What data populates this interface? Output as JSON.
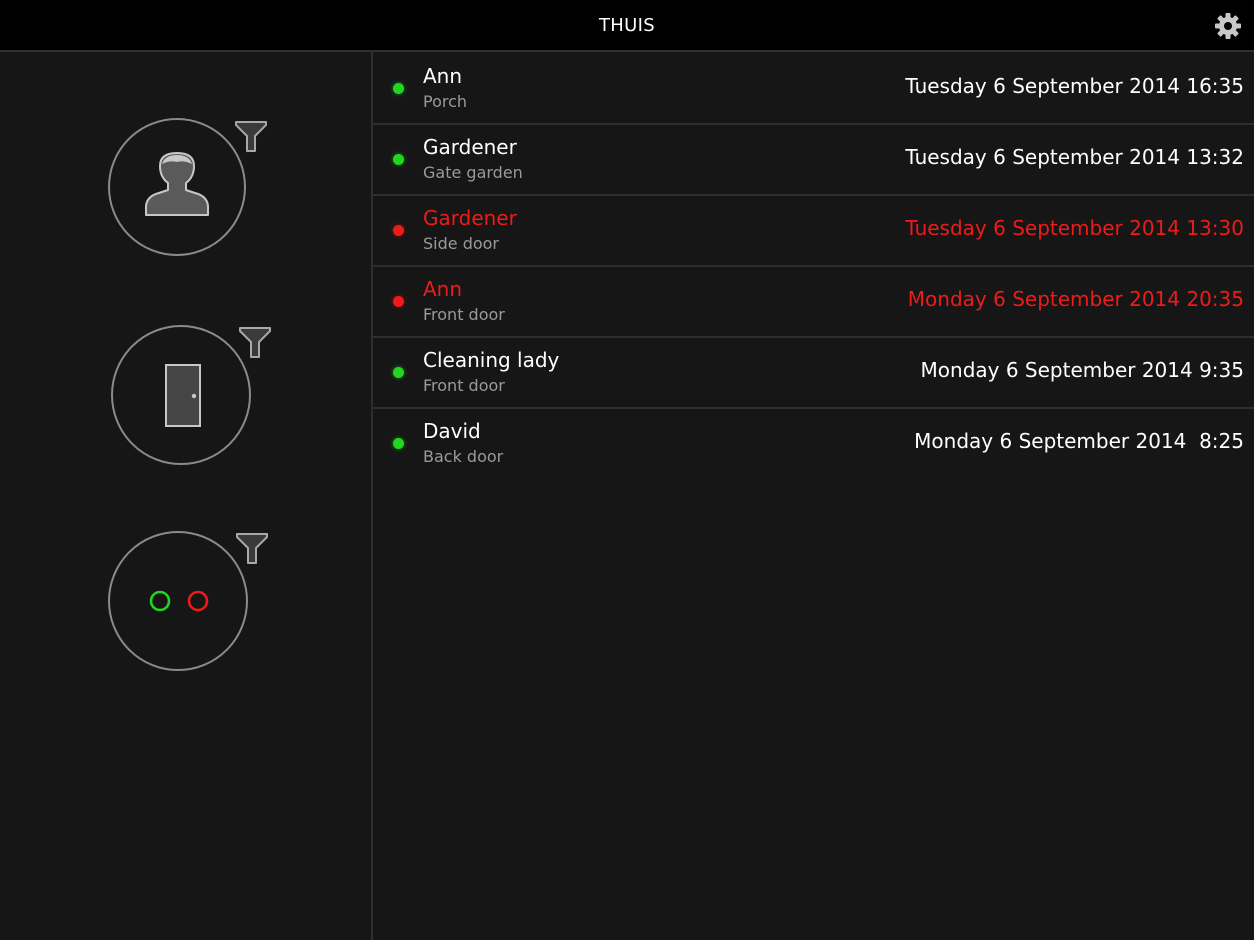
{
  "header": {
    "title": "THUIS",
    "settings_icon": "gear-icon"
  },
  "sidebar": {
    "filters": [
      {
        "name": "person-filter",
        "icon": "person-icon",
        "funnel_icon": "funnel-icon"
      },
      {
        "name": "door-filter",
        "icon": "door-icon",
        "funnel_icon": "funnel-icon"
      },
      {
        "name": "status-filter",
        "icon": "status-dots-icon",
        "funnel_icon": "funnel-icon"
      }
    ]
  },
  "colors": {
    "granted": "#22d51f",
    "denied": "#ee1b1b",
    "background": "#161616",
    "topbar": "#000000"
  },
  "events": [
    {
      "name": "Ann",
      "door": "Porch",
      "when": "Tuesday 6 September 2014 16:35",
      "status": "granted"
    },
    {
      "name": "Gardener",
      "door": "Gate garden",
      "when": "Tuesday 6 September 2014 13:32",
      "status": "granted"
    },
    {
      "name": "Gardener",
      "door": "Side door",
      "when": "Tuesday 6 September 2014 13:30",
      "status": "denied"
    },
    {
      "name": "Ann",
      "door": "Front door",
      "when": "Monday 6 September 2014 20:35",
      "status": "denied"
    },
    {
      "name": "Cleaning lady",
      "door": "Front door",
      "when": "Monday 6 September 2014 9:35",
      "status": "granted"
    },
    {
      "name": "David",
      "door": "Back door",
      "when": "Monday 6 September 2014  8:25",
      "status": "granted"
    }
  ]
}
